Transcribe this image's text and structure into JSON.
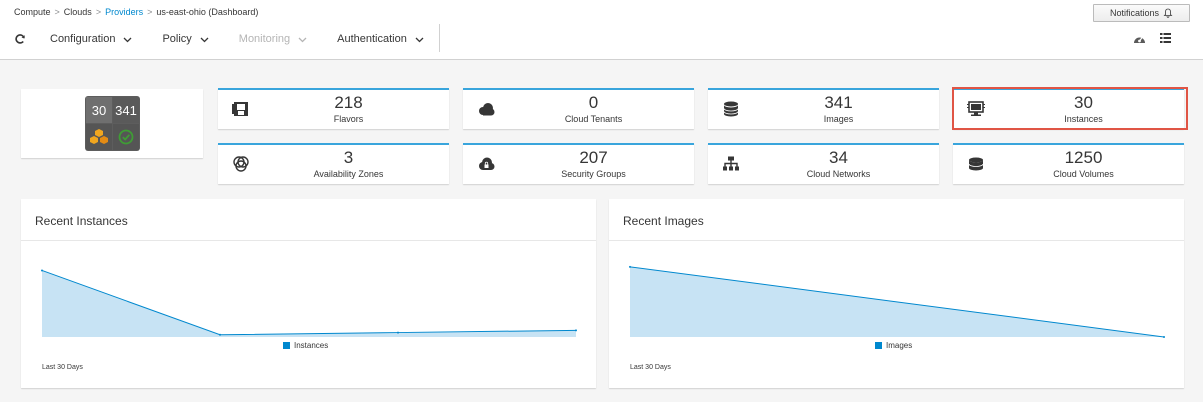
{
  "breadcrumb": {
    "items": [
      "Compute",
      "Clouds",
      "Providers",
      "us-east-ohio (Dashboard)"
    ]
  },
  "notifications": {
    "label": "Notifications",
    "icon": "bell-icon"
  },
  "toolbar": {
    "refresh_icon": "refresh-icon",
    "menus": [
      {
        "label": "Configuration",
        "enabled": true
      },
      {
        "label": "Policy",
        "enabled": true
      },
      {
        "label": "Monitoring",
        "enabled": false
      },
      {
        "label": "Authentication",
        "enabled": true
      }
    ],
    "view_icons": [
      "dashboard-view-icon",
      "list-view-icon"
    ]
  },
  "quadicon": {
    "top_left": "30",
    "top_right": "341",
    "bottom_left_icon": "aws-logo-icon",
    "bottom_right_icon": "status-ok-icon"
  },
  "cards": [
    {
      "count": "218",
      "label": "Flavors",
      "icon": "flavor-icon"
    },
    {
      "count": "0",
      "label": "Cloud Tenants",
      "icon": "cloud-tenant-icon"
    },
    {
      "count": "341",
      "label": "Images",
      "icon": "database-icon"
    },
    {
      "count": "30",
      "label": "Instances",
      "icon": "monitor-icon"
    },
    {
      "count": "3",
      "label": "Availability Zones",
      "icon": "zones-icon"
    },
    {
      "count": "207",
      "label": "Security Groups",
      "icon": "cloud-lock-icon"
    },
    {
      "count": "34",
      "label": "Cloud Networks",
      "icon": "network-icon"
    },
    {
      "count": "1250",
      "label": "Cloud Volumes",
      "icon": "volume-icon"
    }
  ],
  "colors": {
    "accent": "#0088ce",
    "card_border": "#39a5dc",
    "highlight": "#e05545",
    "area_fill": "#c7e3f4"
  },
  "chart_data": [
    {
      "type": "area",
      "title": "Recent Instances",
      "footer": "Last 30 Days",
      "series": [
        {
          "name": "Instances",
          "values": [
            30,
            1,
            2,
            3
          ]
        }
      ],
      "x_points": [
        0,
        1,
        2,
        3
      ],
      "ylim": [
        0,
        32
      ]
    },
    {
      "type": "area",
      "title": "Recent Images",
      "footer": "Last 30 Days",
      "series": [
        {
          "name": "Images",
          "values": [
            341,
            0
          ]
        }
      ],
      "x_points": [
        0,
        1
      ],
      "ylim": [
        0,
        345
      ]
    }
  ]
}
